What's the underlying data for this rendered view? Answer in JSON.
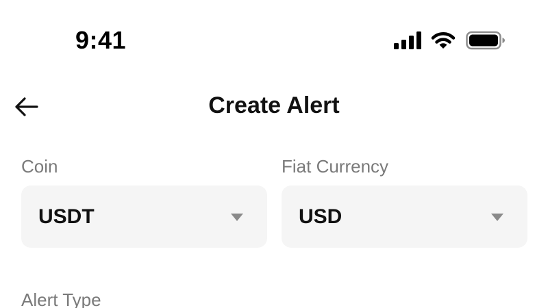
{
  "status_bar": {
    "time": "9:41",
    "icons": [
      "signal-icon",
      "wifi-icon",
      "battery-icon"
    ]
  },
  "header": {
    "title": "Create Alert",
    "back_icon": "arrow-left-icon"
  },
  "form": {
    "coin": {
      "label": "Coin",
      "value": "USDT",
      "icon": "caret-down-icon"
    },
    "fiat_currency": {
      "label": "Fiat Currency",
      "value": "USD",
      "icon": "caret-down-icon"
    },
    "alert_type": {
      "label": "Alert Type"
    }
  },
  "colors": {
    "background": "#ffffff",
    "text_primary": "#111111",
    "text_label": "#7a7a7a",
    "field_background": "#f5f5f5",
    "caret": "#8a8a8a"
  }
}
